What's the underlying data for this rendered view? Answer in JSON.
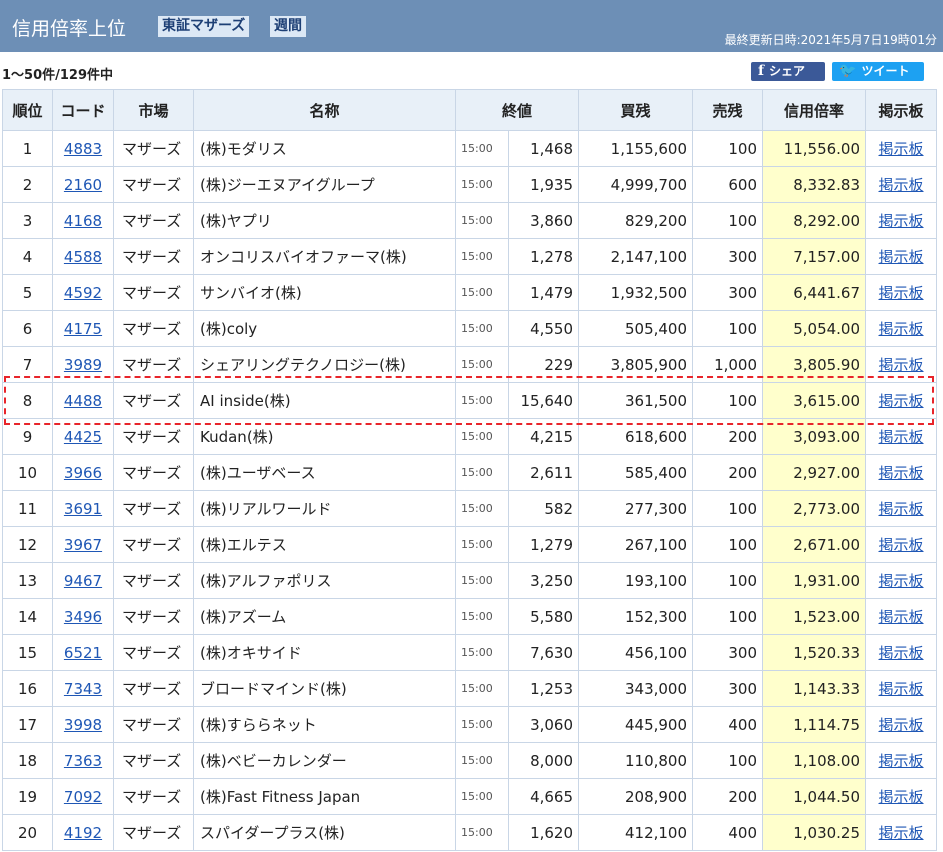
{
  "header": {
    "title": "信用倍率上位",
    "market_tag": "東証マザーズ",
    "period_tag": "週間",
    "updated": "最終更新日時:2021年5月7日19時01分"
  },
  "count_text": "1〜50件/129件中",
  "share": {
    "facebook": "シェア",
    "twitter": "ツイート"
  },
  "columns": {
    "rank": "順位",
    "code": "コード",
    "market": "市場",
    "name": "名称",
    "close": "終値",
    "buy": "買残",
    "sell": "売残",
    "ratio": "信用倍率",
    "board": "掲示板"
  },
  "rows": [
    {
      "rank": "1",
      "code": "4883",
      "market": "マザーズ",
      "name": "(株)モダリス",
      "time": "15:00",
      "close": "1,468",
      "buy": "1,155,600",
      "sell": "100",
      "ratio": "11,556.00",
      "board": "掲示板"
    },
    {
      "rank": "2",
      "code": "2160",
      "market": "マザーズ",
      "name": "(株)ジーエヌアイグループ",
      "time": "15:00",
      "close": "1,935",
      "buy": "4,999,700",
      "sell": "600",
      "ratio": "8,332.83",
      "board": "掲示板"
    },
    {
      "rank": "3",
      "code": "4168",
      "market": "マザーズ",
      "name": "(株)ヤプリ",
      "time": "15:00",
      "close": "3,860",
      "buy": "829,200",
      "sell": "100",
      "ratio": "8,292.00",
      "board": "掲示板"
    },
    {
      "rank": "4",
      "code": "4588",
      "market": "マザーズ",
      "name": "オンコリスバイオファーマ(株)",
      "time": "15:00",
      "close": "1,278",
      "buy": "2,147,100",
      "sell": "300",
      "ratio": "7,157.00",
      "board": "掲示板"
    },
    {
      "rank": "5",
      "code": "4592",
      "market": "マザーズ",
      "name": "サンバイオ(株)",
      "time": "15:00",
      "close": "1,479",
      "buy": "1,932,500",
      "sell": "300",
      "ratio": "6,441.67",
      "board": "掲示板"
    },
    {
      "rank": "6",
      "code": "4175",
      "market": "マザーズ",
      "name": "(株)coly",
      "time": "15:00",
      "close": "4,550",
      "buy": "505,400",
      "sell": "100",
      "ratio": "5,054.00",
      "board": "掲示板"
    },
    {
      "rank": "7",
      "code": "3989",
      "market": "マザーズ",
      "name": "シェアリングテクノロジー(株)",
      "time": "15:00",
      "close": "229",
      "buy": "3,805,900",
      "sell": "1,000",
      "ratio": "3,805.90",
      "board": "掲示板"
    },
    {
      "rank": "8",
      "code": "4488",
      "market": "マザーズ",
      "name": "AI inside(株)",
      "time": "15:00",
      "close": "15,640",
      "buy": "361,500",
      "sell": "100",
      "ratio": "3,615.00",
      "board": "掲示板"
    },
    {
      "rank": "9",
      "code": "4425",
      "market": "マザーズ",
      "name": "Kudan(株)",
      "time": "15:00",
      "close": "4,215",
      "buy": "618,600",
      "sell": "200",
      "ratio": "3,093.00",
      "board": "掲示板"
    },
    {
      "rank": "10",
      "code": "3966",
      "market": "マザーズ",
      "name": "(株)ユーザベース",
      "time": "15:00",
      "close": "2,611",
      "buy": "585,400",
      "sell": "200",
      "ratio": "2,927.00",
      "board": "掲示板"
    },
    {
      "rank": "11",
      "code": "3691",
      "market": "マザーズ",
      "name": "(株)リアルワールド",
      "time": "15:00",
      "close": "582",
      "buy": "277,300",
      "sell": "100",
      "ratio": "2,773.00",
      "board": "掲示板"
    },
    {
      "rank": "12",
      "code": "3967",
      "market": "マザーズ",
      "name": "(株)エルテス",
      "time": "15:00",
      "close": "1,279",
      "buy": "267,100",
      "sell": "100",
      "ratio": "2,671.00",
      "board": "掲示板"
    },
    {
      "rank": "13",
      "code": "9467",
      "market": "マザーズ",
      "name": "(株)アルファポリス",
      "time": "15:00",
      "close": "3,250",
      "buy": "193,100",
      "sell": "100",
      "ratio": "1,931.00",
      "board": "掲示板"
    },
    {
      "rank": "14",
      "code": "3496",
      "market": "マザーズ",
      "name": "(株)アズーム",
      "time": "15:00",
      "close": "5,580",
      "buy": "152,300",
      "sell": "100",
      "ratio": "1,523.00",
      "board": "掲示板"
    },
    {
      "rank": "15",
      "code": "6521",
      "market": "マザーズ",
      "name": "(株)オキサイド",
      "time": "15:00",
      "close": "7,630",
      "buy": "456,100",
      "sell": "300",
      "ratio": "1,520.33",
      "board": "掲示板"
    },
    {
      "rank": "16",
      "code": "7343",
      "market": "マザーズ",
      "name": "ブロードマインド(株)",
      "time": "15:00",
      "close": "1,253",
      "buy": "343,000",
      "sell": "300",
      "ratio": "1,143.33",
      "board": "掲示板"
    },
    {
      "rank": "17",
      "code": "3998",
      "market": "マザーズ",
      "name": "(株)すららネット",
      "time": "15:00",
      "close": "3,060",
      "buy": "445,900",
      "sell": "400",
      "ratio": "1,114.75",
      "board": "掲示板"
    },
    {
      "rank": "18",
      "code": "7363",
      "market": "マザーズ",
      "name": "(株)ベビーカレンダー",
      "time": "15:00",
      "close": "8,000",
      "buy": "110,800",
      "sell": "100",
      "ratio": "1,108.00",
      "board": "掲示板"
    },
    {
      "rank": "19",
      "code": "7092",
      "market": "マザーズ",
      "name": "(株)Fast Fitness Japan",
      "time": "15:00",
      "close": "4,665",
      "buy": "208,900",
      "sell": "200",
      "ratio": "1,044.50",
      "board": "掲示板"
    },
    {
      "rank": "20",
      "code": "4192",
      "market": "マザーズ",
      "name": "スパイダープラス(株)",
      "time": "15:00",
      "close": "1,620",
      "buy": "412,100",
      "sell": "400",
      "ratio": "1,030.25",
      "board": "掲示板"
    }
  ]
}
